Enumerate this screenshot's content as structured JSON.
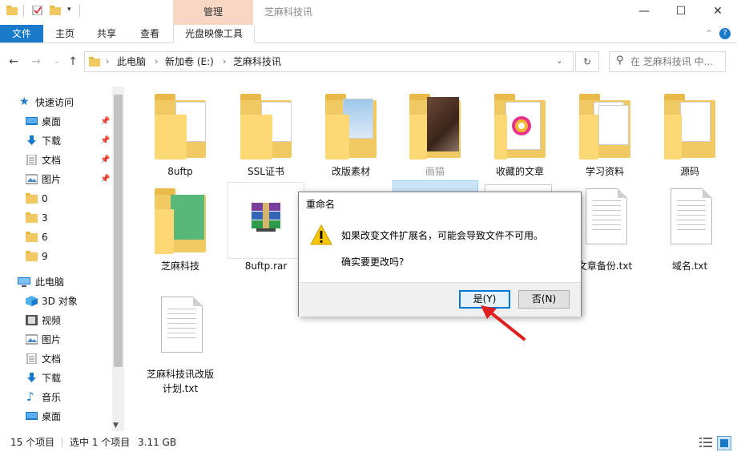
{
  "window": {
    "title": "芝麻科技讯",
    "context_tab": "管理",
    "controls": {
      "minimize": "—",
      "maximize": "☐",
      "close": "✕"
    }
  },
  "ribbon": {
    "tabs": [
      "文件",
      "主页",
      "共享",
      "查看",
      "光盘映像工具"
    ],
    "collapse_icon": "⌃",
    "help_icon": "?"
  },
  "address": {
    "path": [
      "此电脑",
      "新加卷 (E:)",
      "芝麻科技讯"
    ],
    "search_placeholder": "在 芝麻科技讯 中...",
    "dropdown_icon": "⌄",
    "refresh_icon": "↻"
  },
  "nav": {
    "quick_access_label": "快速访问",
    "pinned": [
      "桌面",
      "下载",
      "文档",
      "图片"
    ],
    "folders": [
      "0",
      "3",
      "6",
      "9"
    ],
    "this_pc_label": "此电脑",
    "this_pc_items": [
      "3D 对象",
      "视频",
      "图片",
      "文档",
      "下载",
      "音乐",
      "桌面"
    ]
  },
  "files": [
    {
      "name": "8uftp",
      "type": "folder"
    },
    {
      "name": "SSL证书",
      "type": "folder"
    },
    {
      "name": "改版素材",
      "type": "folder"
    },
    {
      "name": "画猫",
      "type": "folder"
    },
    {
      "name": "收藏的文章",
      "type": "folder"
    },
    {
      "name": "学习资料",
      "type": "folder"
    },
    {
      "name": "源码",
      "type": "folder"
    },
    {
      "name": "芝麻科技",
      "type": "folder"
    },
    {
      "name": "8uftp.rar",
      "type": "rar"
    },
    {
      "name": "文章备份.txt",
      "type": "txt"
    },
    {
      "name": "域名.txt",
      "type": "txt"
    },
    {
      "name": "芝麻科技讯改版计划.txt",
      "type": "txt"
    }
  ],
  "dialog": {
    "title": "重命名",
    "message": "如果改变文件扩展名，可能会导致文件不可用。",
    "question": "确实要更改吗?",
    "yes_label": "是(Y)",
    "no_label": "否(N)",
    "warning_icon": "!"
  },
  "status": {
    "count": "15 个项目",
    "selection": "选中 1 个项目",
    "size": "3.11 GB"
  },
  "colors": {
    "accent": "#1979ca",
    "manage_tab": "#f7d7c4",
    "folder": "#ffd876",
    "arrow": "#e02020"
  }
}
